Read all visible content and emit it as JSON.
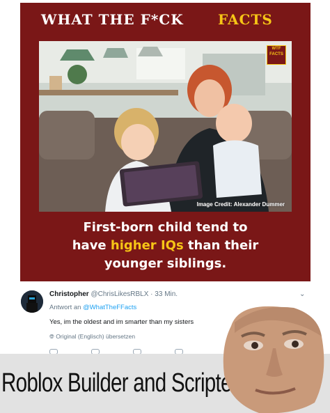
{
  "card": {
    "header_white": "WHAT THE F*CK",
    "header_yellow": "FACTS",
    "badge": "WTF FACTS",
    "credit": "Image Credit: Alexander Dummer",
    "caption_line1": "First-born child tend to",
    "caption_line2_a": "have ",
    "caption_line2_hl": "higher IQs",
    "caption_line2_b": " than their",
    "caption_line3": "younger siblings."
  },
  "tweet": {
    "name": "Christopher",
    "handle_time": "@ChrisLikesRBLX · 33 Min.",
    "reply_prefix": "Antwort an ",
    "reply_to": "@WhatTheFFacts",
    "text": "Yes, im the oldest and im smarter than my sisters",
    "translate": "Original (Englisch) übersetzen",
    "chevron": "⌄"
  },
  "banner": {
    "text": "Roblox Builder and Scripter"
  },
  "colors": {
    "card_bg": "#7a1717",
    "accent_yellow": "#f6c516",
    "twitter_blue": "#1da1f2"
  }
}
